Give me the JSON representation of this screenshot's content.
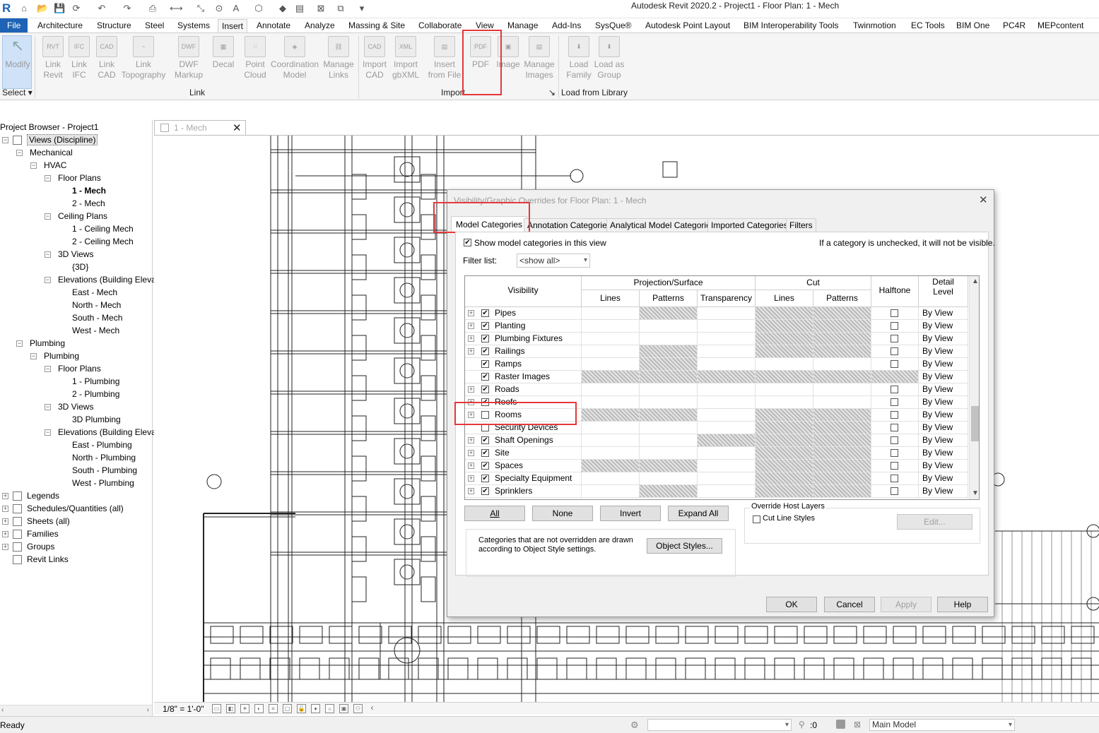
{
  "title": "Autodesk Revit 2020.2 - Project1 - Floor Plan: 1 - Mech",
  "tabs": [
    "File",
    "Architecture",
    "Structure",
    "Steel",
    "Systems",
    "Insert",
    "Annotate",
    "Analyze",
    "Massing & Site",
    "Collaborate",
    "View",
    "Manage",
    "Add-Ins",
    "SysQue®",
    "Autodesk Point Layout",
    "BIM Interoperability Tools",
    "Twinmotion",
    "EC Tools",
    "BIM One",
    "PC4R",
    "MEPcontent"
  ],
  "active_tab": "Insert",
  "ribbon": {
    "buttons": [
      {
        "l1": "Modify",
        "l2": "",
        "icon": "pointer-icon"
      },
      {
        "l1": "Link",
        "l2": "Revit",
        "icon": "rvt-icon",
        "ico": "RVT"
      },
      {
        "l1": "Link",
        "l2": "IFC",
        "icon": "ifc-icon",
        "ico": "IFC"
      },
      {
        "l1": "Link",
        "l2": "CAD",
        "icon": "cad-icon",
        "ico": "CAD"
      },
      {
        "l1": "Link",
        "l2": "Topography",
        "icon": "topography-icon",
        "ico": "~"
      },
      {
        "l1": "DWF",
        "l2": "Markup",
        "icon": "dwf-icon",
        "ico": "DWF"
      },
      {
        "l1": "Decal",
        "l2": "",
        "icon": "decal-icon",
        "ico": "▦"
      },
      {
        "l1": "Point",
        "l2": "Cloud",
        "icon": "point-cloud-icon",
        "ico": "⁙"
      },
      {
        "l1": "Coordination",
        "l2": "Model",
        "icon": "coordination-icon",
        "ico": "◈"
      },
      {
        "l1": "Manage",
        "l2": "Links",
        "icon": "manage-links-icon",
        "ico": "⛓"
      },
      {
        "l1": "Import",
        "l2": "CAD",
        "icon": "import-cad-icon",
        "ico": "CAD"
      },
      {
        "l1": "Import",
        "l2": "gbXML",
        "icon": "gbxml-icon",
        "ico": "XML"
      },
      {
        "l1": "Insert",
        "l2": "from File",
        "icon": "insert-file-icon",
        "ico": "▤"
      },
      {
        "l1": "PDF",
        "l2": "",
        "icon": "pdf-icon",
        "ico": "PDF"
      },
      {
        "l1": "Image",
        "l2": "",
        "icon": "image-icon",
        "ico": "▣"
      },
      {
        "l1": "Manage",
        "l2": "Images",
        "icon": "manage-images-icon",
        "ico": "▤"
      },
      {
        "l1": "Load",
        "l2": "Family",
        "icon": "load-family-icon",
        "ico": "⬇"
      },
      {
        "l1": "Load as",
        "l2": "Group",
        "icon": "load-group-icon",
        "ico": "⬇"
      }
    ],
    "panels": {
      "select": "Select",
      "link": "Link",
      "import": "Import",
      "library": "Load from Library"
    }
  },
  "browser": {
    "title": "Project Browser - Project1",
    "items": [
      {
        "label": "Views (Discipline)",
        "level": 0,
        "selected": true
      },
      {
        "label": "Mechanical",
        "level": 1
      },
      {
        "label": "HVAC",
        "level": 2
      },
      {
        "label": "Floor Plans",
        "level": 3
      },
      {
        "label": "1 - Mech",
        "level": 4,
        "bold": true
      },
      {
        "label": "2 - Mech",
        "level": 4
      },
      {
        "label": "Ceiling Plans",
        "level": 3
      },
      {
        "label": "1 - Ceiling Mech",
        "level": 4
      },
      {
        "label": "2 - Ceiling Mech",
        "level": 4
      },
      {
        "label": "3D Views",
        "level": 3
      },
      {
        "label": "{3D}",
        "level": 4
      },
      {
        "label": "Elevations (Building Eleva",
        "level": 3
      },
      {
        "label": "East - Mech",
        "level": 4
      },
      {
        "label": "North - Mech",
        "level": 4
      },
      {
        "label": "South - Mech",
        "level": 4
      },
      {
        "label": "West - Mech",
        "level": 4
      },
      {
        "label": "Plumbing",
        "level": 1
      },
      {
        "label": "Plumbing",
        "level": 2
      },
      {
        "label": "Floor Plans",
        "level": 3
      },
      {
        "label": "1 - Plumbing",
        "level": 4
      },
      {
        "label": "2 - Plumbing",
        "level": 4
      },
      {
        "label": "3D Views",
        "level": 3
      },
      {
        "label": "3D Plumbing",
        "level": 4
      },
      {
        "label": "Elevations (Building Eleva",
        "level": 3
      },
      {
        "label": "East - Plumbing",
        "level": 4
      },
      {
        "label": "North - Plumbing",
        "level": 4
      },
      {
        "label": "South - Plumbing",
        "level": 4
      },
      {
        "label": "West - Plumbing",
        "level": 4
      },
      {
        "label": "Legends",
        "level": 0
      },
      {
        "label": "Schedules/Quantities (all)",
        "level": 0
      },
      {
        "label": "Sheets (all)",
        "level": 0
      },
      {
        "label": "Families",
        "level": 0
      },
      {
        "label": "Groups",
        "level": 0
      },
      {
        "label": "Revit Links",
        "level": 0
      }
    ]
  },
  "view_tab": "1 - Mech",
  "dialog": {
    "title": "Visibility/Graphic Overrides for Floor Plan: 1 - Mech",
    "tabs": [
      "Model Categories",
      "Annotation Categories",
      "Analytical Model Categories",
      "Imported Categories",
      "Filters"
    ],
    "show_label": "Show model categories in this view",
    "hint": "If a category is unchecked, it will not be visible.",
    "filter_label": "Filter list:",
    "filter_value": "<show all>",
    "headers": {
      "visibility": "Visibility",
      "projection": "Projection/Surface",
      "cut": "Cut",
      "lines": "Lines",
      "patterns": "Patterns",
      "transparency": "Transparency",
      "halftone": "Halftone",
      "detail": "Detail Level"
    },
    "rows": [
      {
        "name": "Pipes",
        "checked": true
      },
      {
        "name": "Planting",
        "checked": true
      },
      {
        "name": "Plumbing Fixtures",
        "checked": true
      },
      {
        "name": "Railings",
        "checked": true
      },
      {
        "name": "Ramps",
        "checked": true
      },
      {
        "name": "Raster Images",
        "checked": true
      },
      {
        "name": "Roads",
        "checked": true
      },
      {
        "name": "Roofs",
        "checked": true
      },
      {
        "name": "Rooms",
        "checked": false
      },
      {
        "name": "Security Devices",
        "checked": false
      },
      {
        "name": "Shaft Openings",
        "checked": true
      },
      {
        "name": "Site",
        "checked": true
      },
      {
        "name": "Spaces",
        "checked": true
      },
      {
        "name": "Specialty Equipment",
        "checked": true
      },
      {
        "name": "Sprinklers",
        "checked": true
      }
    ],
    "detail_value": "By View",
    "buttons": {
      "all": "All",
      "none": "None",
      "invert": "Invert",
      "expand": "Expand All",
      "object_styles": "Object Styles...",
      "edit": "Edit...",
      "ok": "OK",
      "cancel": "Cancel",
      "apply": "Apply",
      "help": "Help"
    },
    "note": "Categories that are not overridden are drawn according to Object Style settings.",
    "override_group": "Override Host Layers",
    "cut_line_styles": "Cut Line Styles"
  },
  "viewbar": {
    "scale": "1/8\" = 1'-0\""
  },
  "status": {
    "text": "Ready",
    "zero": ":0",
    "model": "Main Model"
  },
  "colors": {
    "accent": "#1e63b5",
    "highlight": "#e5383b"
  }
}
